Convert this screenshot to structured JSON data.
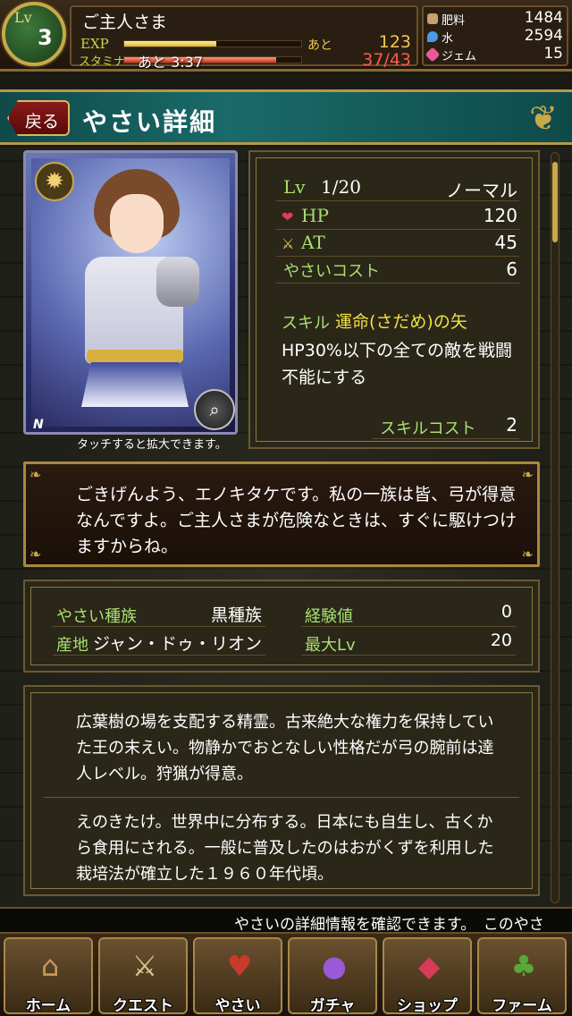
{
  "header": {
    "level_label": "Lv",
    "level": "3",
    "player_name": "ご主人さま",
    "exp_label": "EXP",
    "exp_remaining_label": "あと",
    "exp_remaining": "123",
    "exp_progress": 0.52,
    "stamina_label": "スタミナ",
    "stamina_timer": "あと 3:37",
    "stamina_value": "37/43",
    "stamina_progress": 0.86,
    "resources": [
      {
        "name": "肥料",
        "value": "1484",
        "icon": "fertilizer-icon",
        "color": "#c8a070"
      },
      {
        "name": "水",
        "value": "2594",
        "icon": "water-icon",
        "color": "#4a9ae8"
      },
      {
        "name": "ジェム",
        "value": "15",
        "icon": "gem-icon",
        "color": "#e85a9a"
      }
    ]
  },
  "titlebar": {
    "back_label": "戻る",
    "title": "やさい詳細"
  },
  "card": {
    "rarity": "N",
    "caption": "タッチすると拡大できます。"
  },
  "stats": {
    "level_label": "Lv",
    "level_value": "1/20",
    "rarity_name": "ノーマル",
    "hp_label": "HP",
    "hp_value": "120",
    "at_label": "AT",
    "at_value": "45",
    "cost_label": "やさいコスト",
    "cost_value": "6",
    "skill_label": "スキル",
    "skill_name": "運命(さだめ)の矢",
    "skill_desc": "HP30%以下の全ての敵を戦闘不能にする",
    "skill_cost_label": "スキルコスト",
    "skill_cost_value": "2"
  },
  "quote": "ごきげんよう、エノキタケです。私の一族は皆、弓が得意なんですよ。ご主人さまが危険なときは、すぐに駆けつけますからね。",
  "info": {
    "tribe_label": "やさい種族",
    "tribe_value": "黒種族",
    "origin_label": "産地",
    "origin_value": "ジャン・ドゥ・リオン",
    "exp_label": "経験値",
    "exp_value": "0",
    "maxlv_label": "最大Lv",
    "maxlv_value": "20"
  },
  "description": {
    "flavor": "広葉樹の場を支配する精霊。古来絶大な権力を保持していた王の末えい。物静かでおとなしい性格だが弓の腕前は達人レベル。狩猟が得意。",
    "fact": "えのきたけ。世界中に分布する。日本にも自生し、古くから食用にされる。一般に普及したのはおがくずを利用した栽培法が確立した１９６０年代頃。"
  },
  "ticker": "やさいの詳細情報を確認できます。　このやさ",
  "nav": [
    {
      "label": "ホーム",
      "icon": "house-icon",
      "glyph": "⌂",
      "color": "#c89a5a"
    },
    {
      "label": "クエスト",
      "icon": "quest-map-icon",
      "glyph": "⚔",
      "color": "#d8c890"
    },
    {
      "label": "やさい",
      "icon": "cards-icon",
      "glyph": "♥",
      "color": "#c83a2a"
    },
    {
      "label": "ガチャ",
      "icon": "gacha-egg-icon",
      "glyph": "●",
      "color": "#9a5ad8"
    },
    {
      "label": "ショップ",
      "icon": "gem-shop-icon",
      "glyph": "◆",
      "color": "#d83a5a"
    },
    {
      "label": "ファーム",
      "icon": "sprout-icon",
      "glyph": "♣",
      "color": "#5aa83a"
    }
  ]
}
